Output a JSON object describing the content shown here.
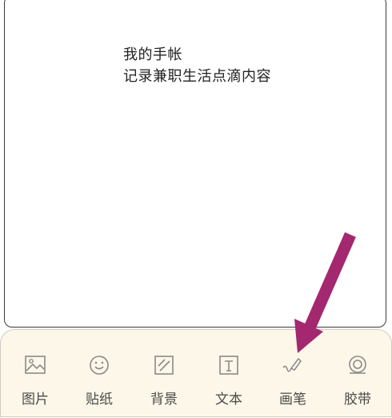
{
  "note": {
    "title": "我的手帐",
    "subtitle": "记录兼职生活点滴内容"
  },
  "toolbar": {
    "items": [
      {
        "label": "图片",
        "icon": "image-icon"
      },
      {
        "label": "贴纸",
        "icon": "smiley-icon"
      },
      {
        "label": "背景",
        "icon": "background-icon"
      },
      {
        "label": "文本",
        "icon": "text-icon"
      },
      {
        "label": "画笔",
        "icon": "pen-icon"
      },
      {
        "label": "胶带",
        "icon": "tape-icon"
      }
    ]
  },
  "colors": {
    "toolbar_bg": "#fdf7e9",
    "icon_stroke": "#8a8a8a",
    "arrow": "#a3286f"
  }
}
